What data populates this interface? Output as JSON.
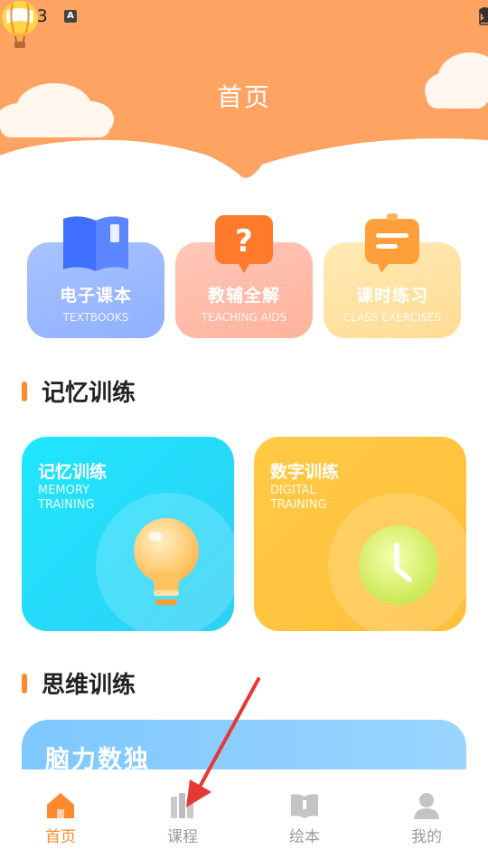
{
  "status_bar": {
    "time": "4:23",
    "notification_icon": "A"
  },
  "header": {
    "title": "首页",
    "logo_icon": "hot-air-balloon-icon"
  },
  "top_cards": [
    {
      "title": "电子课本",
      "subtitle": "TEXTBOOKS",
      "icon": "book-icon",
      "color": "#8fb0ff"
    },
    {
      "title": "教辅全解",
      "subtitle": "TEACHING AIDS",
      "icon": "question-bubble-icon",
      "color": "#ffb9a6"
    },
    {
      "title": "课时练习",
      "subtitle": "CLASS EXERCISES",
      "icon": "chat-note-icon",
      "color": "#ffe09c"
    }
  ],
  "sections": {
    "memory": "记忆训练",
    "thinking": "思维训练"
  },
  "training_cards": [
    {
      "title": "记忆训练",
      "subtitle_line1": "MEMORY",
      "subtitle_line2": "TRAINING",
      "icon": "lightbulb-icon",
      "color": "#23d8f8"
    },
    {
      "title": "数字训练",
      "subtitle_line1": "DIGITAL",
      "subtitle_line2": "TRAINING",
      "icon": "clock-icon",
      "color": "#ffc53c"
    }
  ],
  "sudoku_card": {
    "title": "脑力数独"
  },
  "bottom_nav": [
    {
      "label": "首页",
      "icon": "home-icon",
      "active": true
    },
    {
      "label": "课程",
      "icon": "books-icon",
      "active": false
    },
    {
      "label": "绘本",
      "icon": "picture-book-icon",
      "active": false
    },
    {
      "label": "我的",
      "icon": "user-icon",
      "active": false
    }
  ],
  "colors": {
    "header": "#ffa363",
    "accent": "#ff8a2c",
    "nav_active": "#ff8a2c",
    "nav_inactive": "#9a9a9a"
  }
}
